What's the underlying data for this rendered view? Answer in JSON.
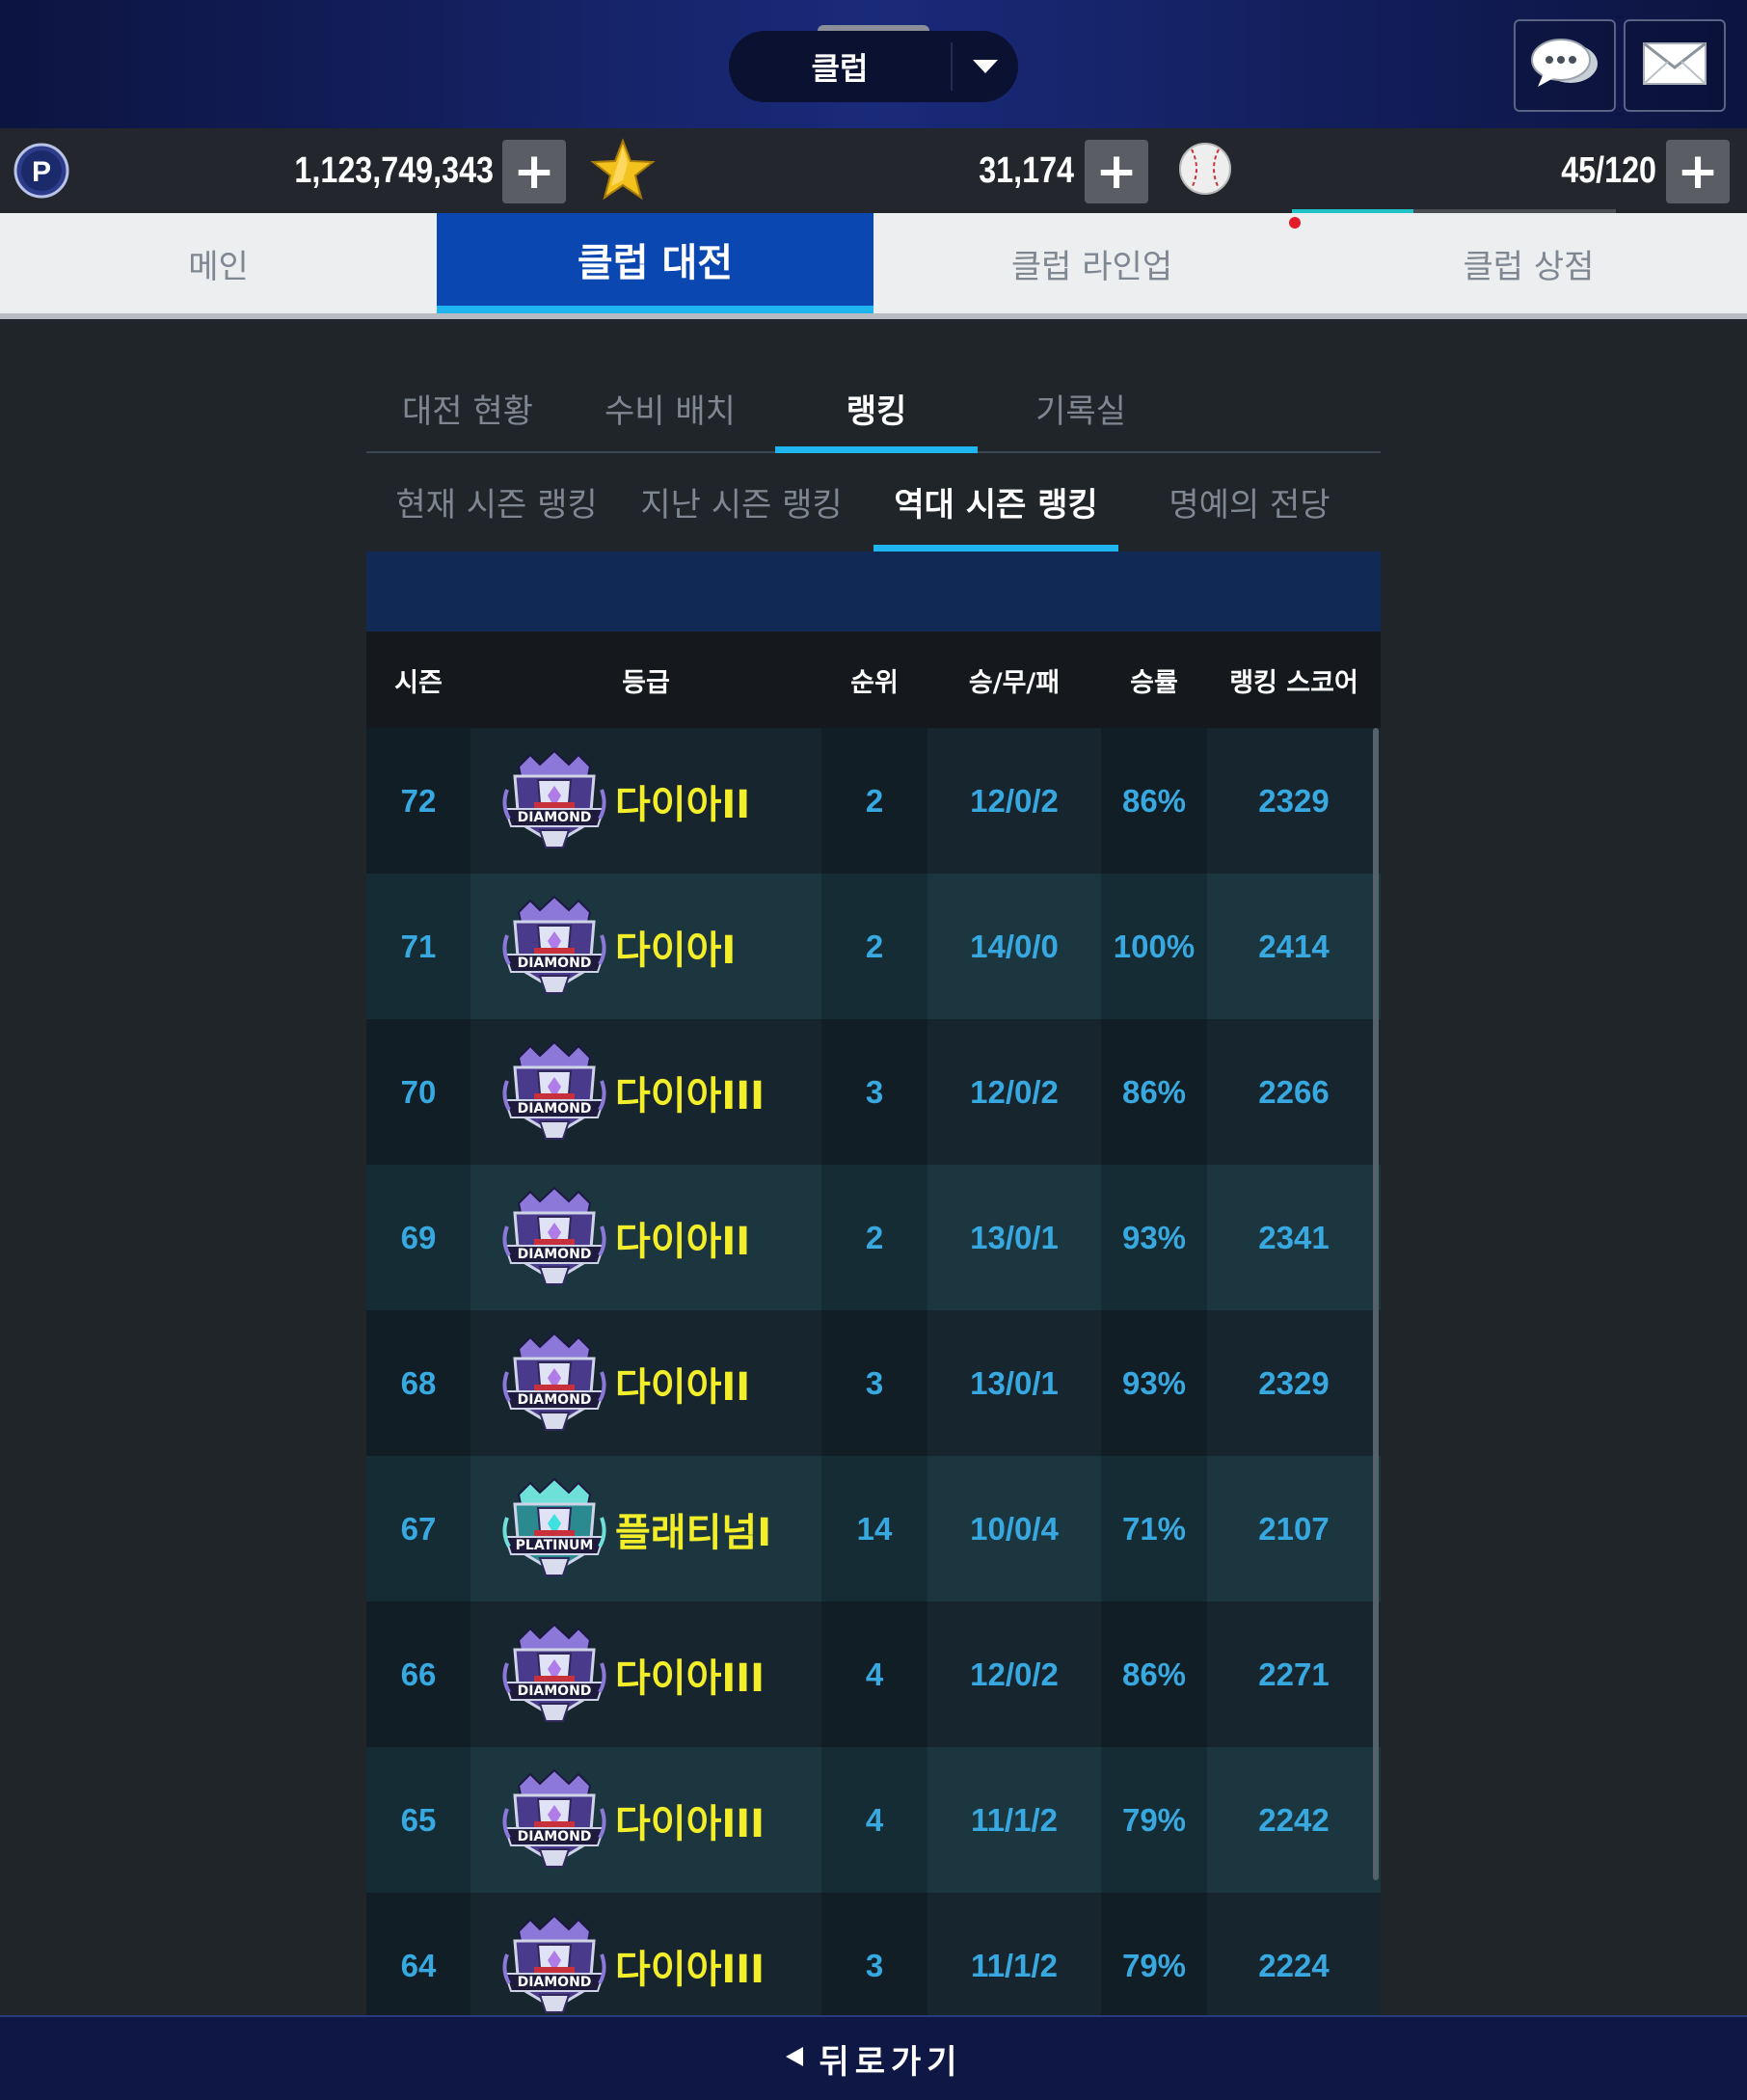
{
  "header": {
    "title": "클럽"
  },
  "currency": {
    "points": "1,123,749,343",
    "stars": "31,174",
    "energy": "45/120",
    "energy_level": 0.375
  },
  "main_tabs": [
    "메인",
    "클럽 대전",
    "클럽 라인업",
    "클럽 상점"
  ],
  "sub_tabs": [
    "대전 현황",
    "수비 배치",
    "랭킹",
    "기록실"
  ],
  "ranking_tabs": [
    "현재 시즌 랭킹",
    "지난 시즌 랭킹",
    "역대 시즌 랭킹",
    "명예의 전당"
  ],
  "table": {
    "headers": [
      "시즌",
      "등급",
      "순위",
      "승/무/패",
      "승률",
      "랭킹 스코어"
    ],
    "rows": [
      {
        "season": "72",
        "badge": "diamond",
        "badge_text": "DIAMOND",
        "grade": "다이아II",
        "rank": "2",
        "record": "12/0/2",
        "winrate": "86%",
        "score": "2329"
      },
      {
        "season": "71",
        "badge": "diamond",
        "badge_text": "DIAMOND",
        "grade": "다이아I",
        "rank": "2",
        "record": "14/0/0",
        "winrate": "100%",
        "score": "2414"
      },
      {
        "season": "70",
        "badge": "diamond",
        "badge_text": "DIAMOND",
        "grade": "다이아III",
        "rank": "3",
        "record": "12/0/2",
        "winrate": "86%",
        "score": "2266"
      },
      {
        "season": "69",
        "badge": "diamond",
        "badge_text": "DIAMOND",
        "grade": "다이아II",
        "rank": "2",
        "record": "13/0/1",
        "winrate": "93%",
        "score": "2341"
      },
      {
        "season": "68",
        "badge": "diamond",
        "badge_text": "DIAMOND",
        "grade": "다이아II",
        "rank": "3",
        "record": "13/0/1",
        "winrate": "93%",
        "score": "2329"
      },
      {
        "season": "67",
        "badge": "platinum",
        "badge_text": "PLATINUM",
        "grade": "플래티넘I",
        "rank": "14",
        "record": "10/0/4",
        "winrate": "71%",
        "score": "2107"
      },
      {
        "season": "66",
        "badge": "diamond",
        "badge_text": "DIAMOND",
        "grade": "다이아III",
        "rank": "4",
        "record": "12/0/2",
        "winrate": "86%",
        "score": "2271"
      },
      {
        "season": "65",
        "badge": "diamond",
        "badge_text": "DIAMOND",
        "grade": "다이아III",
        "rank": "4",
        "record": "11/1/2",
        "winrate": "79%",
        "score": "2242"
      },
      {
        "season": "64",
        "badge": "diamond",
        "badge_text": "DIAMOND",
        "grade": "다이아III",
        "rank": "3",
        "record": "11/1/2",
        "winrate": "79%",
        "score": "2224"
      }
    ]
  },
  "footer": {
    "back_label": "뒤로가기"
  },
  "colors": {
    "accent": "#1fb5f0",
    "active_tab": "#0a47b0",
    "grade_text": "#f3ee2a",
    "cell_text": "#38a8e0"
  },
  "icons": {
    "points": "p-coin-icon",
    "stars": "star-icon",
    "energy": "baseball-icon",
    "chat": "chat-icon",
    "mail": "mail-icon",
    "dropdown": "caret-down-icon",
    "back": "back-arrow-icon"
  }
}
